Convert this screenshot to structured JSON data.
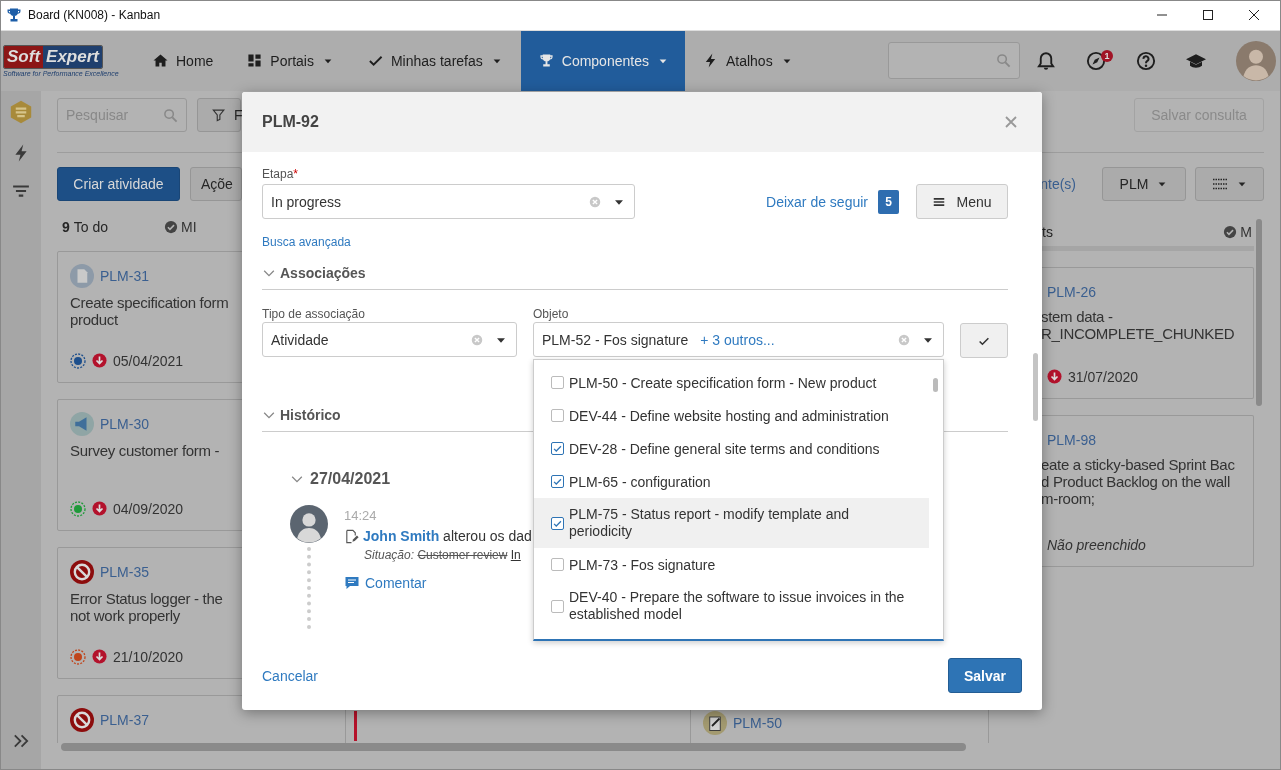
{
  "window": {
    "title": "Board (KN008) - Kanban"
  },
  "nav": {
    "brand": [
      "Soft",
      "Expert"
    ],
    "tagline": "Software for Performance Excellence",
    "items": [
      {
        "label": "Home",
        "dropdown": false,
        "selected": false
      },
      {
        "label": "Portais",
        "dropdown": true,
        "selected": false
      },
      {
        "label": "Minhas tarefas",
        "dropdown": true,
        "selected": false
      },
      {
        "label": "Componentes",
        "dropdown": true,
        "selected": true
      },
      {
        "label": "Atalhos",
        "dropdown": true,
        "selected": false
      }
    ],
    "notification_badge": "1"
  },
  "toolbar": {
    "search": {
      "placeholder": "Pesquisar"
    },
    "filter_button": "F",
    "create_button": "Criar atividade",
    "actions_button": "Açõe",
    "save_query": {
      "label": "Salvar consulta",
      "disabled": true
    },
    "followers_link": "nte(s)",
    "project_button": "PLM"
  },
  "columns": [
    {
      "count": "9",
      "title": "To do",
      "milestone": "MI",
      "cards": [
        {
          "id": "PLM-31",
          "kind": "document",
          "title_lines": [
            "Create specification form",
            "product"
          ],
          "footer": {
            "kind": "date",
            "color": "#1d4f8c",
            "text": "05/04/2021"
          }
        },
        {
          "id": "PLM-30",
          "kind": "survey",
          "title_lines": [
            "Survey customer form -"
          ],
          "footer": {
            "kind": "date",
            "color": "#1f9a3a",
            "text": "04/09/2020"
          }
        },
        {
          "id": "PLM-35",
          "kind": "error",
          "title_lines": [
            "Error Status logger - the",
            "not work properly"
          ],
          "footer": {
            "kind": "date",
            "color": "#c0451b",
            "text": "21/10/2020"
          }
        },
        {
          "id": "PLM-37",
          "kind": "error"
        }
      ]
    },
    {
      "cards": [
        {
          "color": "#b5122a"
        }
      ]
    },
    {
      "cards": [
        {
          "id": "PLM-50",
          "kind": "clipboard"
        }
      ]
    },
    {
      "title": "ts",
      "milestone": "M",
      "cards": [
        {
          "id": "PLM-26",
          "title_lines": [
            "stem data -",
            "R_INCOMPLETE_CHUNKED"
          ],
          "footer": {
            "kind": "date",
            "text": "31/07/2020"
          }
        },
        {
          "id": "PLM-98",
          "title_lines": [
            "eate a sticky-based Sprint Bac",
            "d Product Backlog on the wall",
            "m-room;"
          ],
          "footer": {
            "kind": "empty",
            "text": "Não preenchido"
          }
        }
      ]
    }
  ],
  "dialog": {
    "title": "PLM-92",
    "stage": {
      "label": "Etapa",
      "required_mark": "*",
      "value": "In progress"
    },
    "unfollow_link": "Deixar de seguir",
    "followers_count": "5",
    "menu_button": "Menu",
    "advanced_search_link": "Busca avançada",
    "associations": {
      "title": "Associações",
      "expanded": true,
      "type": {
        "label": "Tipo de associação",
        "value": "Atividade"
      },
      "object": {
        "label": "Objeto",
        "value": "PLM-52 - Fos signature",
        "more_link": "+ 3 outros...",
        "options": [
          {
            "text": "PLM-50 - Create specification form - New product",
            "checked": false,
            "highlighted": false
          },
          {
            "text": "DEV-44 - Define website hosting and administration",
            "checked": false,
            "highlighted": false
          },
          {
            "text": "DEV-28 - Define general site terms and conditions",
            "checked": true,
            "highlighted": false
          },
          {
            "text": "PLM-65 - configuration",
            "checked": true,
            "highlighted": false
          },
          {
            "text": "PLM-75 - Status report - modify template and periodicity",
            "checked": true,
            "highlighted": true
          },
          {
            "text": "PLM-73 - Fos signature",
            "checked": false,
            "highlighted": false
          },
          {
            "text": "DEV-40 - Prepare the software to issue invoices in the established model",
            "checked": false,
            "highlighted": false
          }
        ]
      }
    },
    "history": {
      "title": "Histórico",
      "expanded": true,
      "days": [
        {
          "date": "27/04/2021",
          "expanded": true,
          "entries": [
            {
              "time": "14:24",
              "user": "John Smith",
              "action": "alterou os dad",
              "field": "Situação:",
              "old_value": "Customer review",
              "new_value": "In",
              "comment_link": "Comentar"
            }
          ]
        }
      ]
    },
    "cancel_link": "Cancelar",
    "save_button": "Salvar"
  }
}
